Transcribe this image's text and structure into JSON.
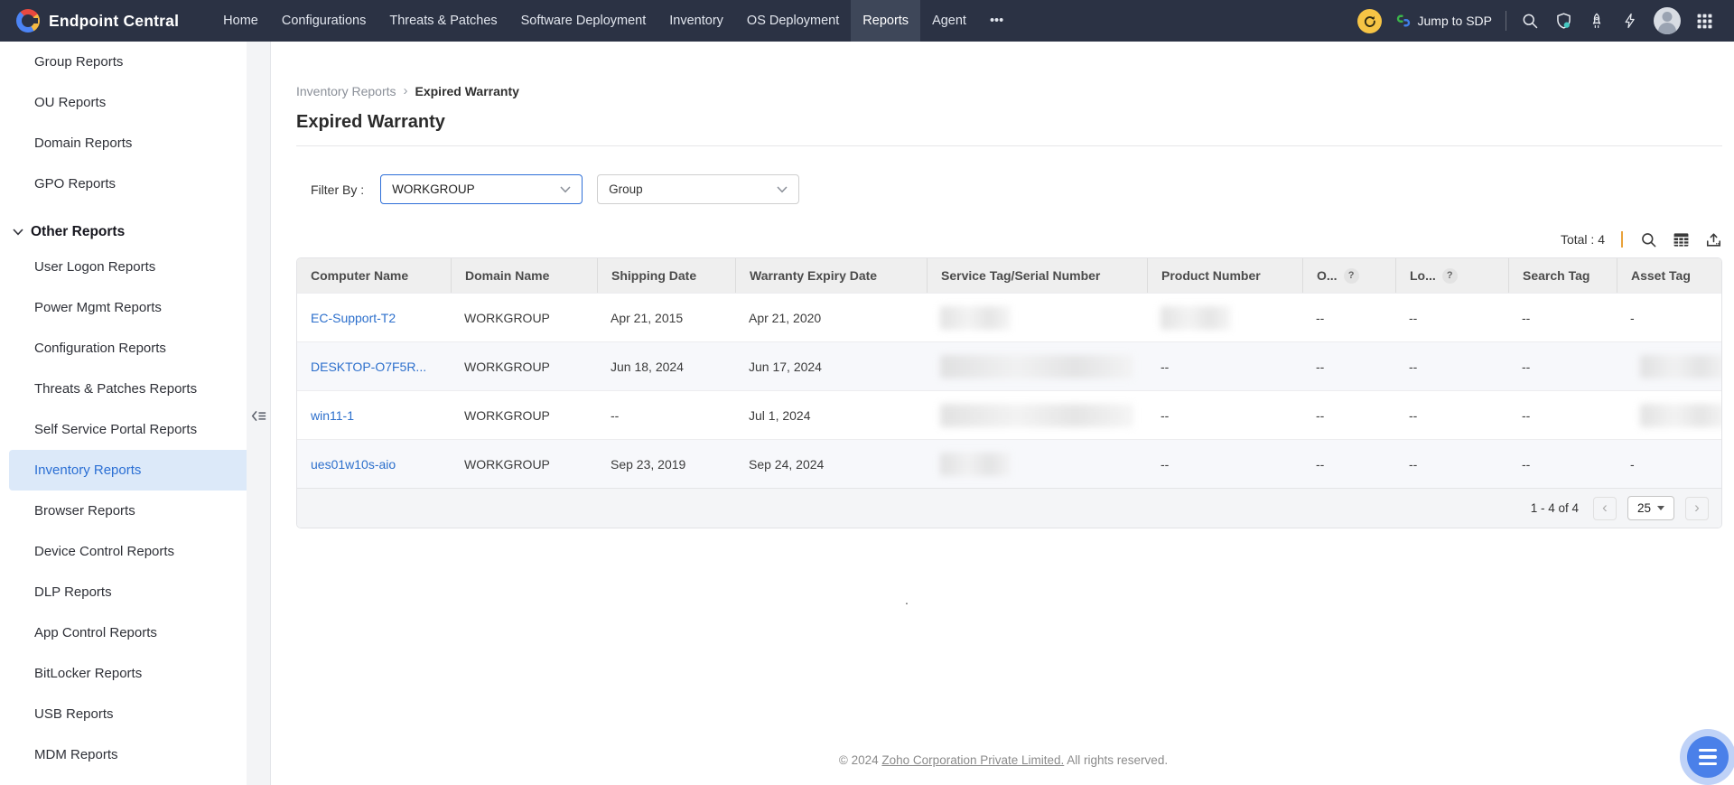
{
  "topnav": {
    "brand": "Endpoint Central",
    "items": [
      {
        "label": "Home"
      },
      {
        "label": "Configurations"
      },
      {
        "label": "Threats & Patches"
      },
      {
        "label": "Software Deployment"
      },
      {
        "label": "Inventory"
      },
      {
        "label": "OS Deployment"
      },
      {
        "label": "Reports"
      },
      {
        "label": "Agent"
      },
      {
        "label": "•••"
      }
    ],
    "active_item": "Reports",
    "jump_to_sdp_label": "Jump to SDP",
    "colors": {
      "bar_bg": "#2b3244",
      "active_bg": "#3e4759",
      "refresh_yellow": "#f6c445",
      "shield_badge": "#45c7c1"
    }
  },
  "sidebar": {
    "top_items": [
      "Group Reports",
      "OU Reports",
      "Domain Reports",
      "GPO Reports"
    ],
    "section_label": "Other Reports",
    "items": [
      "User Logon Reports",
      "Power Mgmt Reports",
      "Configuration Reports",
      "Threats & Patches Reports",
      "Self Service Portal Reports",
      "Inventory Reports",
      "Browser Reports",
      "Device Control Reports",
      "DLP Reports",
      "App Control Reports",
      "BitLocker Reports",
      "USB Reports",
      "MDM Reports"
    ],
    "active_item": "Inventory Reports",
    "colors": {
      "active_bg": "#dce9f9",
      "active_text": "#2b6fd4"
    }
  },
  "breadcrumb": {
    "parent": "Inventory Reports",
    "separator": "›",
    "current": "Expired Warranty"
  },
  "page": {
    "title": "Expired Warranty"
  },
  "filters": {
    "label": "Filter By :",
    "scope_value": "WORKGROUP",
    "group_value": "Group"
  },
  "table": {
    "total_label": "Total : 4",
    "columns": [
      "Computer Name",
      "Domain Name",
      "Shipping Date",
      "Warranty Expiry Date",
      "Service Tag/Serial Number",
      "Product Number",
      "O...",
      "Lo...",
      "Search Tag",
      "Asset Tag"
    ],
    "help_badge": "?",
    "rows": [
      {
        "computer_name": "EC-Support-T2",
        "domain_name": "WORKGROUP",
        "shipping_date": "Apr 21, 2015",
        "warranty_expiry_date": "Apr 21, 2020",
        "service_tag": null,
        "product_number": null,
        "col_o": "--",
        "col_lo": "--",
        "search_tag": "--",
        "asset_tag": "-"
      },
      {
        "computer_name": "DESKTOP-O7F5R...",
        "domain_name": "WORKGROUP",
        "shipping_date": "Jun 18, 2024",
        "warranty_expiry_date": "Jun 17, 2024",
        "service_tag": null,
        "product_number": "--",
        "col_o": "--",
        "col_lo": "--",
        "search_tag": "--",
        "asset_tag": null
      },
      {
        "computer_name": "win11-1",
        "domain_name": "WORKGROUP",
        "shipping_date": "--",
        "warranty_expiry_date": "Jul 1, 2024",
        "service_tag": null,
        "product_number": "--",
        "col_o": "--",
        "col_lo": "--",
        "search_tag": "--",
        "asset_tag": null
      },
      {
        "computer_name": "ues01w10s-aio",
        "domain_name": "WORKGROUP",
        "shipping_date": "Sep 23, 2019",
        "warranty_expiry_date": "Sep 24, 2024",
        "service_tag": null,
        "product_number": "--",
        "col_o": "--",
        "col_lo": "--",
        "search_tag": "--",
        "asset_tag": "-"
      }
    ]
  },
  "pagination": {
    "range": "1 - 4 of 4",
    "prev": "‹",
    "next": "›",
    "page_size": "25"
  },
  "misc": {
    "stray_dot": "."
  },
  "footer": {
    "prefix": "© 2024",
    "link": "Zoho Corporation Private Limited.",
    "suffix": "All rights reserved."
  }
}
